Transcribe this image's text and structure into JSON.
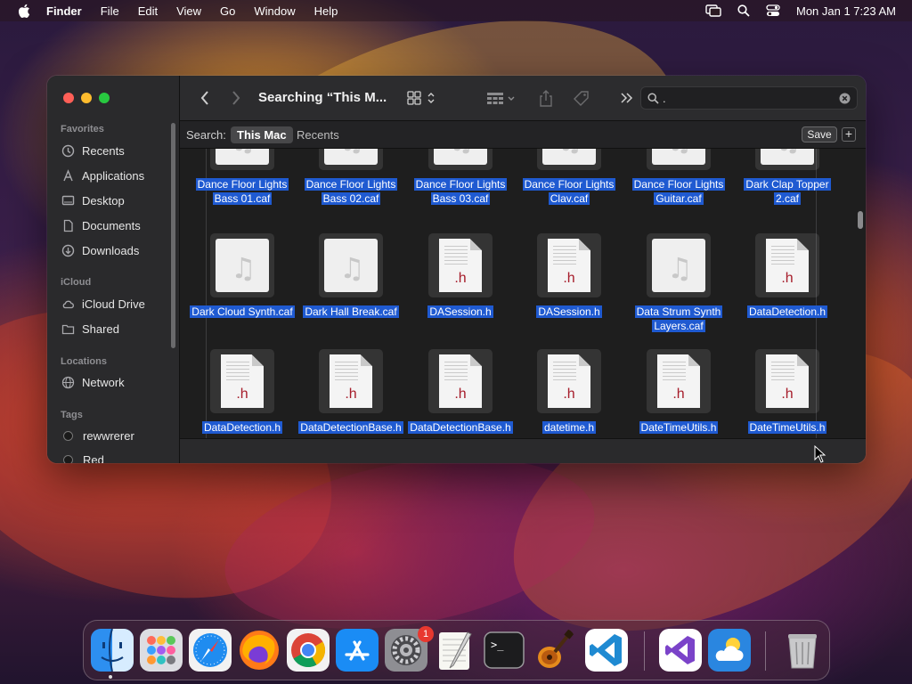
{
  "menubar": {
    "app_name": "Finder",
    "menus": [
      "File",
      "Edit",
      "View",
      "Go",
      "Window",
      "Help"
    ],
    "clock": "Mon Jan 1  7:23 AM",
    "icons": [
      "apple-logo-icon",
      "screen-mirroring-icon",
      "spotlight-search-icon",
      "control-center-icon"
    ]
  },
  "window": {
    "title": "Searching “This M...",
    "search_value": ".",
    "scope": {
      "label": "Search:",
      "options": [
        "This Mac",
        "Recents"
      ],
      "selected": "This Mac",
      "save_label": "Save",
      "add_label": "+"
    }
  },
  "sidebar": {
    "favorites_header": "Favorites",
    "favorites": [
      {
        "label": "Recents",
        "icon": "clock-icon"
      },
      {
        "label": "Applications",
        "icon": "applications-icon"
      },
      {
        "label": "Desktop",
        "icon": "desktop-icon"
      },
      {
        "label": "Documents",
        "icon": "document-icon"
      },
      {
        "label": "Downloads",
        "icon": "download-icon"
      }
    ],
    "icloud_header": "iCloud",
    "icloud": [
      {
        "label": "iCloud Drive",
        "icon": "cloud-icon"
      },
      {
        "label": "Shared",
        "icon": "shared-folder-icon"
      }
    ],
    "locations_header": "Locations",
    "locations": [
      {
        "label": "Network",
        "icon": "globe-icon"
      }
    ],
    "tags_header": "Tags",
    "tags": [
      {
        "label": "rewwrerer"
      },
      {
        "label": "Red"
      }
    ]
  },
  "files": {
    "row1": [
      {
        "name": "Dance Floor Lights Bass 01.caf",
        "type": "audio"
      },
      {
        "name": "Dance Floor Lights Bass 02.caf",
        "type": "audio"
      },
      {
        "name": "Dance Floor Lights Bass 03.caf",
        "type": "audio"
      },
      {
        "name": "Dance Floor Lights Clav.caf",
        "type": "audio"
      },
      {
        "name": "Dance Floor Lights Guitar.caf",
        "type": "audio"
      },
      {
        "name": "Dark Clap Topper 2.caf",
        "type": "audio"
      }
    ],
    "row2": [
      {
        "name": "Dark Cloud Synth.caf",
        "type": "audio"
      },
      {
        "name": "Dark Hall Break.caf",
        "type": "audio"
      },
      {
        "name": "DASession.h",
        "type": "header"
      },
      {
        "name": "DASession.h",
        "type": "header"
      },
      {
        "name": "Data Strum Synth Layers.caf",
        "type": "audio"
      },
      {
        "name": "DataDetection.h",
        "type": "header"
      }
    ],
    "row3": [
      {
        "name": "DataDetection.h",
        "type": "header"
      },
      {
        "name": "DataDetectionBase.h",
        "type": "header"
      },
      {
        "name": "DataDetectionBase.h",
        "type": "header"
      },
      {
        "name": "datetime.h",
        "type": "header"
      },
      {
        "name": "DateTimeUtils.h",
        "type": "header"
      },
      {
        "name": "DateTimeUtils.h",
        "type": "header"
      }
    ],
    "header_ext": ".h",
    "audio_glyph": "♫"
  },
  "dock": {
    "apps": [
      "Finder",
      "Launchpad",
      "Safari",
      "Firefox",
      "Google Chrome",
      "App Store",
      "System Settings",
      "TextEdit",
      "Terminal",
      "GarageBand",
      "Visual Studio Code",
      "Visual Studio",
      "Weather",
      "Trash"
    ],
    "settings_badge": "1",
    "terminal_prompt": ">_"
  },
  "colors": {
    "selection": "#1f5ad1",
    "header_ext": "#a61c2a",
    "close": "#ff5f57",
    "minimize": "#febc2e",
    "zoom": "#28c840"
  }
}
